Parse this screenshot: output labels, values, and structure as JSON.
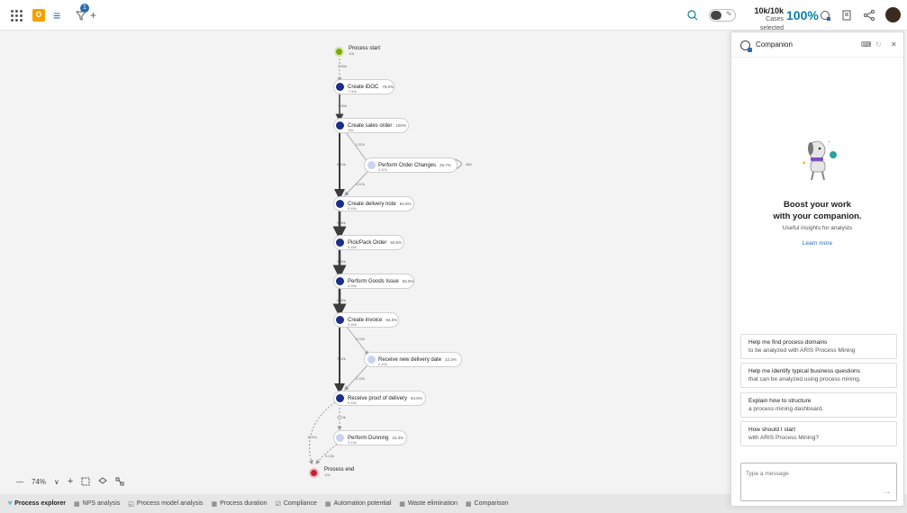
{
  "topbar": {
    "apps_icon": "apps-grid-icon",
    "menu_icon": "hamburger-menu-icon",
    "filter_count": "1",
    "add_label": "+",
    "cases_count": "10k/10k",
    "cases_label": "Cases selected",
    "cases_percent": "100%"
  },
  "process": {
    "start": {
      "name": "Process start",
      "count": "10k",
      "out": "7.90k"
    },
    "nodes": [
      {
        "name": "Create iDOC",
        "count": "7.90k",
        "rate": "79.0%"
      },
      {
        "name": "Create sales order",
        "count": "10k",
        "rate": "100%"
      },
      {
        "name": "Perform Order Changes",
        "count": "2.57k",
        "rate": "25.7%",
        "loop": "484"
      },
      {
        "name": "Create delivery note",
        "count": "9.45k",
        "rate": "94.5%"
      },
      {
        "name": "Pick/Pack Order",
        "count": "9.45k",
        "rate": "94.5%"
      },
      {
        "name": "Perform Goods Issue",
        "count": "9.45k",
        "rate": "94.5%"
      },
      {
        "name": "Create invoice",
        "count": "9.45k",
        "rate": "94.5%"
      },
      {
        "name": "Receive new delivery date",
        "count": "2.22k",
        "rate": "22.2%"
      },
      {
        "name": "Receive proof of delivery",
        "count": "9.45k",
        "rate": "94.5%"
      },
      {
        "name": "Perform Dunning",
        "count": "3.13k",
        "rate": "31.3%"
      }
    ],
    "end": {
      "name": "Process end",
      "count": "10k"
    },
    "edges": {
      "e1": "7.90k",
      "e2": "2.57k",
      "e3": "5.43k",
      "e4": "2.57k",
      "e5": "9.45k",
      "e6": "9.45k",
      "e7": "9.45k",
      "e8": "2.22k",
      "e9": "7.22k",
      "e10": "2.22k",
      "e11": "3.13k",
      "e12": "6.31k",
      "e13": "3.13k"
    }
  },
  "zoom": {
    "value": "74%",
    "minus": "—",
    "plus": "+",
    "chevron": "∨"
  },
  "bottom_tabs": [
    {
      "label": "Process explorer",
      "icon": "process-explorer-icon"
    },
    {
      "label": "NPS analysis",
      "icon": "dashboard-icon"
    },
    {
      "label": "Process model analysis",
      "icon": "model-icon"
    },
    {
      "label": "Process duration",
      "icon": "dashboard-icon"
    },
    {
      "label": "Compliance",
      "icon": "compliance-icon"
    },
    {
      "label": "Automation potential",
      "icon": "dashboard-icon"
    },
    {
      "label": "Waste elimination",
      "icon": "dashboard-icon"
    },
    {
      "label": "Comparison",
      "icon": "dashboard-icon"
    }
  ],
  "companion": {
    "title": "Companion",
    "headline_1": "Boost your work",
    "headline_2": "with your companion.",
    "subtitle": "Useful insights for analysts",
    "learn_more": "Learn more",
    "suggestions": [
      {
        "l1": "Help me find process domains",
        "l2": "to be analyzed with ARIS Process Mining"
      },
      {
        "l1": "Help me identify typical business questions",
        "l2": "that can be analyzed using process mining."
      },
      {
        "l1": "Explain how to structure",
        "l2": "a process mining dashboard."
      },
      {
        "l1": "How should I start",
        "l2": "with ARIS Process Mining?"
      }
    ],
    "message_placeholder": "Type a message"
  },
  "colors": {
    "accent": "#0a7fa8",
    "node": "#1a2e8a",
    "node_light": "#c9d3ec",
    "start": "#7aa90d",
    "end": "#c31f35",
    "app_badge": "#f5a000"
  }
}
